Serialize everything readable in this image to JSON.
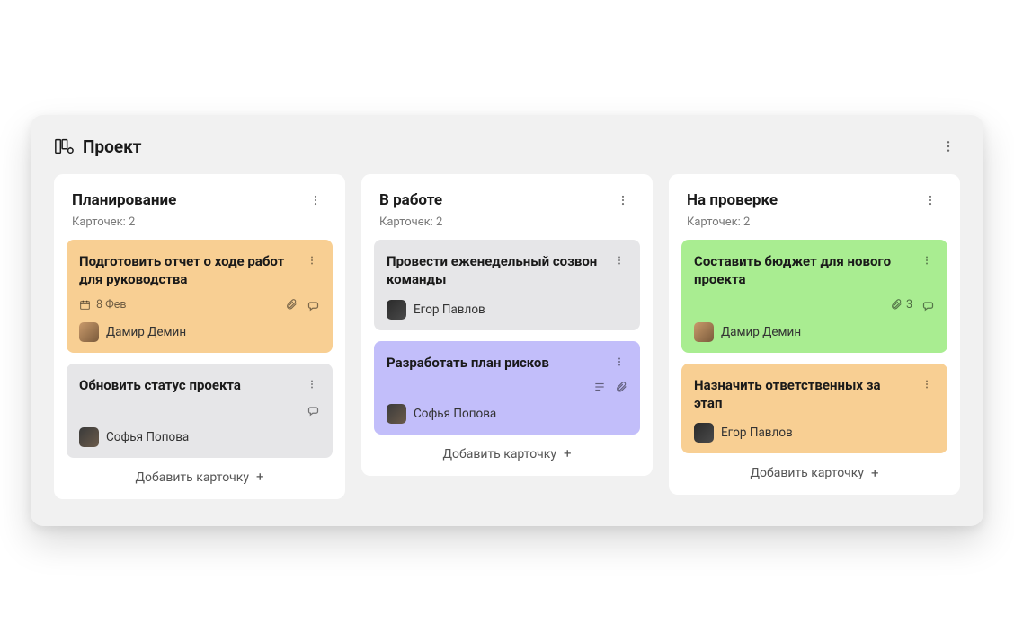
{
  "board": {
    "title": "Проект"
  },
  "addCardLabel": "Добавить карточку",
  "columns": [
    {
      "title": "Планирование",
      "subtitle": "Карточек: 2",
      "cards": [
        {
          "color": "orange",
          "title": "Подготовить отчет о ходе работ для руководства",
          "date": "8 Фев",
          "hasDate": true,
          "hasAttachment": true,
          "hasComments": true,
          "assignee": {
            "name": "Дамир Демин",
            "avatar": "a"
          }
        },
        {
          "color": "grey",
          "title": "Обновить статус проекта",
          "hasComments": true,
          "assignee": {
            "name": "Софья Попова",
            "avatar": "b"
          }
        }
      ]
    },
    {
      "title": "В работе",
      "subtitle": "Карточек: 2",
      "cards": [
        {
          "color": "grey",
          "title": "Провести еженедельный созвон команды",
          "assignee": {
            "name": "Егор Павлов",
            "avatar": "c"
          }
        },
        {
          "color": "violet",
          "title": "Разработать план рисков",
          "hasDescription": true,
          "hasAttachment": true,
          "assignee": {
            "name": "Софья Попова",
            "avatar": "b"
          }
        }
      ]
    },
    {
      "title": "На проверке",
      "subtitle": "Карточек: 2",
      "cards": [
        {
          "color": "green",
          "title": "Составить бюджет для нового проекта",
          "hasAttachment": true,
          "attachmentCount": "3",
          "hasComments": true,
          "assignee": {
            "name": "Дамир Демин",
            "avatar": "a"
          }
        },
        {
          "color": "orange",
          "title": "Назначить ответственных за этап",
          "assignee": {
            "name": "Егор Павлов",
            "avatar": "c"
          }
        }
      ]
    }
  ]
}
